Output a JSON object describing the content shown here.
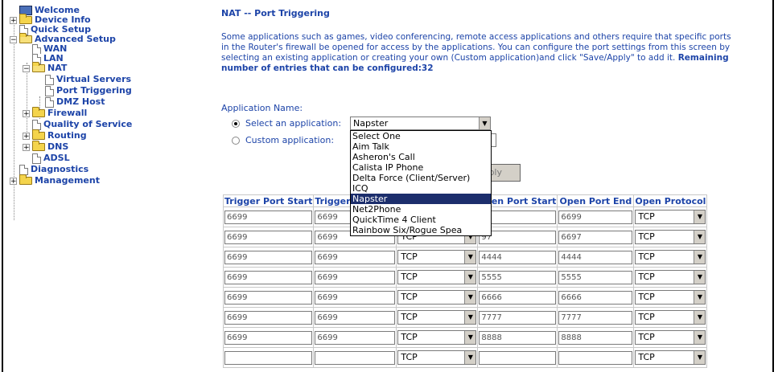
{
  "sidebar": {
    "items": [
      {
        "label": "Welcome",
        "icon": "monitor-icon"
      },
      {
        "label": "Device Info",
        "icon": "folder-icon"
      },
      {
        "label": "Quick Setup",
        "icon": "page-icon"
      },
      {
        "label": "Advanced Setup",
        "icon": "folder-open-icon"
      },
      {
        "label": "WAN",
        "icon": "page-icon"
      },
      {
        "label": "LAN",
        "icon": "page-icon"
      },
      {
        "label": "NAT",
        "icon": "folder-open-icon"
      },
      {
        "label": "Virtual Servers",
        "icon": "page-icon"
      },
      {
        "label": "Port Triggering",
        "icon": "page-icon"
      },
      {
        "label": "DMZ Host",
        "icon": "page-icon"
      },
      {
        "label": "Firewall",
        "icon": "folder-icon"
      },
      {
        "label": "Quality of Service",
        "icon": "page-icon"
      },
      {
        "label": "Routing",
        "icon": "folder-icon"
      },
      {
        "label": "DNS",
        "icon": "folder-icon"
      },
      {
        "label": "ADSL",
        "icon": "page-icon"
      },
      {
        "label": "Diagnostics",
        "icon": "page-icon"
      },
      {
        "label": "Management",
        "icon": "folder-icon"
      }
    ]
  },
  "main": {
    "title": "NAT -- Port Triggering",
    "description": "Some applications such as games, video conferencing, remote access applications and others require that specific ports in the Router's firewall be opened for access by the applications. You can configure the port settings from this screen by selecting an existing application or creating your own (Custom application)and click \"Save/Apply\" to add it.",
    "remaining": "Remaining number of entries that can be configured:32",
    "app_name_label": "Application Name:",
    "select_app_label": "Select an application:",
    "custom_app_label": "Custom application:",
    "selected_app": "Napster",
    "save_apply": "Save/Apply",
    "save_apply_visible": "pply"
  },
  "dropdown": {
    "options": [
      "Select One",
      "Aim Talk",
      "Asheron's Call",
      "Calista IP Phone",
      "Delta Force (Client/Server)",
      "ICQ",
      "Napster",
      "Net2Phone",
      "QuickTime 4 Client",
      "Rainbow Six/Rogue Spea"
    ],
    "selected": "Napster"
  },
  "table": {
    "headers": [
      "Trigger Port Start",
      "Trigger",
      "",
      "en Port Start",
      "Open Port End",
      "Open Protocol"
    ],
    "rows": [
      {
        "tstart": "6699",
        "tend": "6699",
        "tproto": "TCP",
        "ostart": "99",
        "oend": "6699",
        "oproto": "TCP"
      },
      {
        "tstart": "6699",
        "tend": "6699",
        "tproto": "TCP",
        "ostart": "97",
        "oend": "6697",
        "oproto": "TCP"
      },
      {
        "tstart": "6699",
        "tend": "6699",
        "tproto": "TCP",
        "ostart": "4444",
        "oend": "4444",
        "oproto": "TCP"
      },
      {
        "tstart": "6699",
        "tend": "6699",
        "tproto": "TCP",
        "ostart": "5555",
        "oend": "5555",
        "oproto": "TCP"
      },
      {
        "tstart": "6699",
        "tend": "6699",
        "tproto": "TCP",
        "ostart": "6666",
        "oend": "6666",
        "oproto": "TCP"
      },
      {
        "tstart": "6699",
        "tend": "6699",
        "tproto": "TCP",
        "ostart": "7777",
        "oend": "7777",
        "oproto": "TCP"
      },
      {
        "tstart": "6699",
        "tend": "6699",
        "tproto": "TCP",
        "ostart": "8888",
        "oend": "8888",
        "oproto": "TCP"
      },
      {
        "tstart": "",
        "tend": "",
        "tproto": "TCP",
        "ostart": "",
        "oend": "",
        "oproto": "TCP"
      }
    ]
  },
  "colors": {
    "link": "#1d44a8",
    "highlight": "#1c2e6c"
  }
}
